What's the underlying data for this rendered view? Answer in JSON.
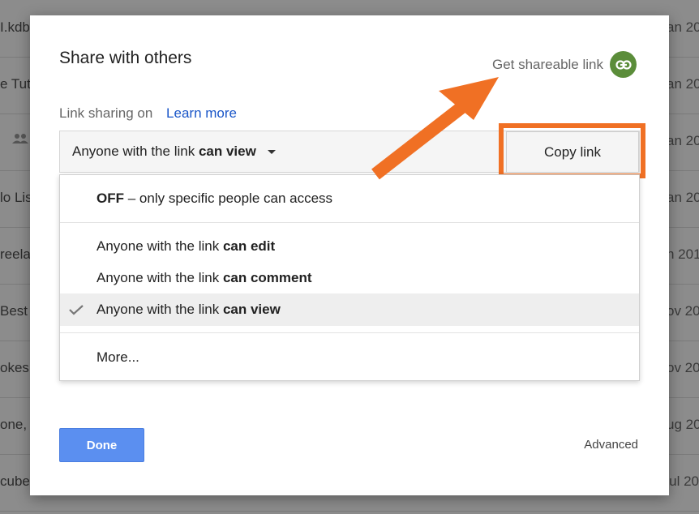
{
  "background": {
    "rows": [
      {
        "left": "I.kdb",
        "right": "an 20"
      },
      {
        "left": "e Tuto",
        "right": "an 20"
      },
      {
        "left": "",
        "right": "an 20"
      },
      {
        "left": "lo Lis",
        "right": "an 20"
      },
      {
        "left": "reela",
        "right": "n 201"
      },
      {
        "left": "Best",
        "right": "ov 20"
      },
      {
        "left": "okes",
        "right": "ov 20"
      },
      {
        "left": "one,",
        "right": "ug 20"
      },
      {
        "left": "cube",
        "right": "ul 20"
      }
    ]
  },
  "dialog": {
    "title": "Share with others",
    "get_shareable_link": "Get shareable link",
    "sharing_status": "Link sharing on",
    "learn_more": "Learn more",
    "dropdown": {
      "prefix": "Anyone with the link",
      "selected": "can view"
    },
    "copy_link": "Copy link",
    "menu": {
      "off_bold": "OFF",
      "off_rest": "– only specific people can access",
      "items": [
        {
          "prefix": "Anyone with the link",
          "level": "can edit",
          "checked": false
        },
        {
          "prefix": "Anyone with the link",
          "level": "can comment",
          "checked": false
        },
        {
          "prefix": "Anyone with the link",
          "level": "can view",
          "checked": true
        }
      ],
      "more": "More..."
    },
    "done": "Done",
    "advanced": "Advanced"
  },
  "colors": {
    "accent_orange": "#f07024",
    "link_green": "#5b8d3a",
    "done_blue": "#5b8ff0",
    "learn_more_blue": "#1a56c8"
  },
  "icons": {
    "get_link": "link-icon",
    "check": "checkmark-icon",
    "people": "people-icon",
    "dropdown": "caret-down-icon"
  }
}
